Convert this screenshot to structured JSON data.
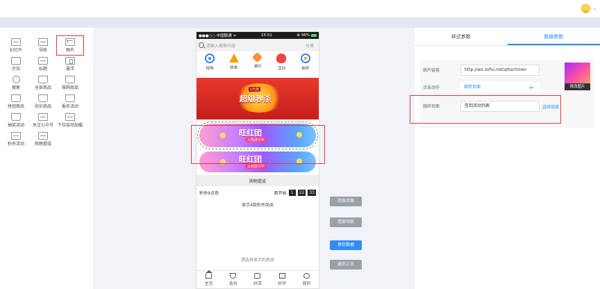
{
  "topbar": {
    "avatar_icon": "smiley-avatar-icon",
    "caret": "⌄"
  },
  "widgets": [
    {
      "label": "幻灯片",
      "icon": "slideshow-icon"
    },
    {
      "label": "导航",
      "icon": "nav-icon"
    },
    {
      "label": "图片",
      "icon": "image-icon",
      "selected": true
    },
    {
      "label": "空白",
      "icon": "blank-icon"
    },
    {
      "label": "标题",
      "icon": "title-icon"
    },
    {
      "label": "悬浮",
      "icon": "float-icon"
    },
    {
      "label": "搜索",
      "icon": "search-icon"
    },
    {
      "label": "全部商品",
      "icon": "bag-icon"
    },
    {
      "label": "限购商品",
      "icon": "bag-icon"
    },
    {
      "label": "拼团商品",
      "icon": "bag-icon"
    },
    {
      "label": "砍价商品",
      "icon": "bag-icon"
    },
    {
      "label": "报名活动",
      "icon": "bag-icon"
    },
    {
      "label": "抽奖活动",
      "icon": "bag-icon"
    },
    {
      "label": "关注公众号",
      "icon": "follow-icon"
    },
    {
      "label": "下拉自动加载",
      "icon": "pull-load-icon"
    },
    {
      "label": "秒杀活动",
      "icon": "seckill-icon"
    },
    {
      "label": "购物提成",
      "icon": "commission-icon"
    }
  ],
  "phone": {
    "status": {
      "left": "●●●○○ 中国联通 ᯤ",
      "time": "15:51",
      "right": "⊕ 46%"
    },
    "search_placeholder": "请输入搜索内容",
    "category_link": "分类",
    "nav": [
      "抢购",
      "拼单",
      "减价",
      "活动",
      "抽奖"
    ],
    "hero": {
      "badge": "1元抢",
      "title": "超级秒杀"
    },
    "banner1": {
      "title": "旺红团",
      "sub": "火热进行中"
    },
    "banner2": {
      "title": "旺红团",
      "sub": "火热进行中"
    },
    "section_title": "购物提成",
    "seckill": {
      "label": "秒杀9点场",
      "prefix": "距开始",
      "h": "1",
      "m": "22",
      "s": "33"
    },
    "seckill_desc": "显示4款秒杀商品",
    "empty_hint": "请选择显示的商品",
    "tabbar": [
      "主页",
      "会员",
      "好店",
      "好评",
      "我的"
    ]
  },
  "mid_buttons": {
    "restore_page": "还原页面",
    "restore_nav": "还原导航",
    "save": "保存数据",
    "back": "返回上页"
  },
  "right": {
    "tabs": [
      "样式参数",
      "数据参数"
    ],
    "active_tab": 1,
    "fields": {
      "image_link_label": "图片链接",
      "image_link_value": "http://wx.zofui.net/attachmen",
      "click_action_label": "点击动作",
      "click_action_value": "跳转页面",
      "jump_page_label": "跳转页面",
      "jump_page_value": "签到活动列表",
      "select_link": "选择链接"
    },
    "modify_image": "修改图片"
  },
  "colors": {
    "accent": "#2f8cf6",
    "highlight": "#e23a3a",
    "dashed": "#3aa335"
  }
}
